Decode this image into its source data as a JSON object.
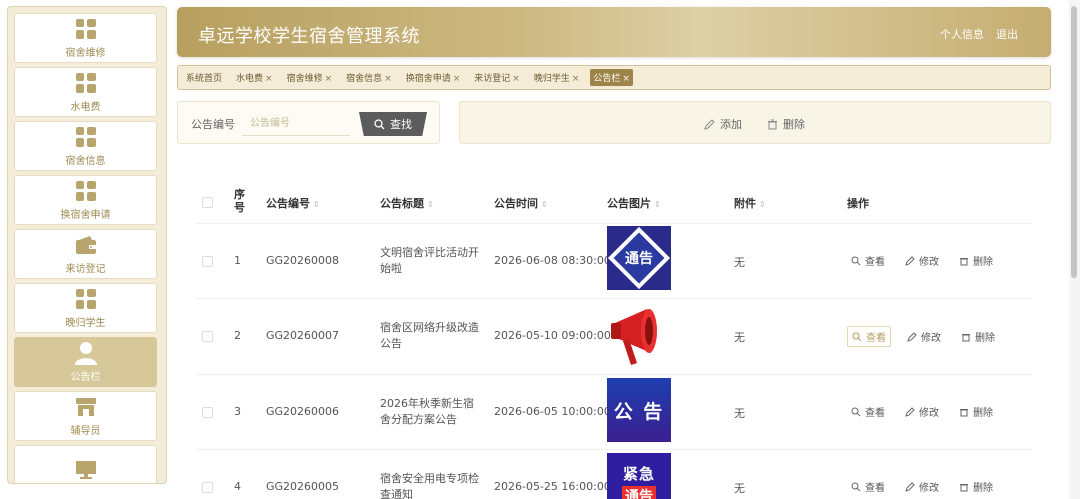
{
  "sidebar": {
    "items": [
      {
        "label": "宿舍维修",
        "icon": "grid-icon"
      },
      {
        "label": "水电费",
        "icon": "grid-icon"
      },
      {
        "label": "宿舍信息",
        "icon": "grid-icon"
      },
      {
        "label": "换宿舍申请",
        "icon": "grid-icon"
      },
      {
        "label": "来访登记",
        "icon": "wallet-icon"
      },
      {
        "label": "晚归学生",
        "icon": "grid-icon"
      },
      {
        "label": "公告栏",
        "icon": "user-icon"
      },
      {
        "label": "辅导员",
        "icon": "shop-icon"
      }
    ],
    "active": "公告栏"
  },
  "header": {
    "title": "卓远学校学生宿舍管理系统",
    "profile": "个人信息",
    "logout": "退出"
  },
  "tabs": [
    {
      "label": "系统首页",
      "closable": false
    },
    {
      "label": "水电费",
      "closable": true
    },
    {
      "label": "宿舍维修",
      "closable": true
    },
    {
      "label": "宿舍信息",
      "closable": true
    },
    {
      "label": "换宿舍申请",
      "closable": true
    },
    {
      "label": "来访登记",
      "closable": true
    },
    {
      "label": "晚归学生",
      "closable": true
    },
    {
      "label": "公告栏",
      "closable": true,
      "active": true
    }
  ],
  "search": {
    "label": "公告编号",
    "placeholder": "公告编号",
    "button": "查找"
  },
  "actions": {
    "add": "添加",
    "delete": "删除"
  },
  "table": {
    "columns": {
      "index": "序号",
      "code": "公告编号",
      "title": "公告标题",
      "time": "公告时间",
      "image": "公告图片",
      "attachment": "附件",
      "ops": "操作"
    },
    "ops_labels": {
      "view": "查看",
      "edit": "修改",
      "delete": "删除"
    },
    "rows": [
      {
        "index": "1",
        "code": "GG20260008",
        "title": "文明宿舍评比活动开始啦",
        "time": "2026-06-08 08:30:00",
        "image": "notice-diamond",
        "image_text": "通告",
        "attachment": "无"
      },
      {
        "index": "2",
        "code": "GG20260007",
        "title": "宿舍区网络升级改造公告",
        "time": "2026-05-10 09:00:00",
        "image": "megaphone",
        "image_text": "",
        "attachment": "无"
      },
      {
        "index": "3",
        "code": "GG20260006",
        "title": "2026年秋季新生宿舍分配方案公告",
        "time": "2026-06-05 10:00:00",
        "image": "announcement-blue",
        "image_text": "公 告",
        "attachment": "无"
      },
      {
        "index": "4",
        "code": "GG20260005",
        "title": "宿舍安全用电专项检查通知",
        "time": "2026-05-25 16:00:00",
        "image": "urgent-notice",
        "image_text": "紧急",
        "image_text2": "通告",
        "attachment": "无"
      }
    ]
  },
  "colors": {
    "accent": "#b79f5f",
    "sidebar_bg": "#f3ecd8",
    "active_tab": "#9d8448",
    "search_button": "#5c5c5c"
  }
}
